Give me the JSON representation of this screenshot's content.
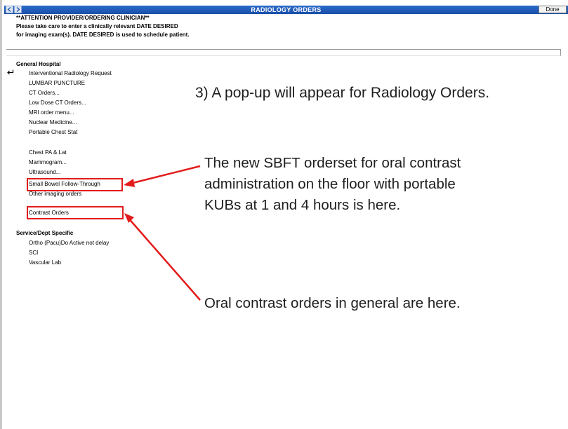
{
  "window": {
    "title": "RADIOLOGY ORDERS",
    "done_label": "Done"
  },
  "header": {
    "line1": "**ATTENTION PROVIDER/ORDERING CLINICIAN**",
    "line2": "Please take care to enter a clinically relevant DATE DESIRED",
    "line3": "for imaging exam(s). DATE DESIRED is used to schedule patient."
  },
  "menu": {
    "general_heading": "General Hospital",
    "general_items": [
      "Interventional Radiology Request",
      "LUMBAR PUNCTURE",
      "CT Orders...",
      "Low Dose CT Orders...",
      "MRI order menu...",
      "Nuclear Medicine...",
      "Portable Chest Stat",
      "Chest PA & Lat",
      "Mammogram...",
      "Ultrasound...",
      "Small Bowel Follow-Through",
      "Other imaging orders",
      "Contrast Orders"
    ],
    "service_heading": "Service/Dept Specific",
    "service_items": [
      "Ortho (Pacu)Do Active not delay",
      "SCI",
      "Vascular Lab"
    ]
  },
  "annotations": {
    "step": "3) A pop-up will appear for Radiology Orders.",
    "sbft_line1": "The new SBFT orderset for oral contrast",
    "sbft_line2": "administration on the floor with portable",
    "sbft_line3": "KUBs at 1 and 4 hours is here.",
    "contrast": "Oral contrast orders in general are here."
  },
  "colors": {
    "titlebar": "#1f5bb8",
    "highlight": "#e31b1b"
  },
  "icons": {
    "back": "back-arrow-icon",
    "forward": "forward-arrow-icon",
    "return": "return-arrow-icon"
  }
}
